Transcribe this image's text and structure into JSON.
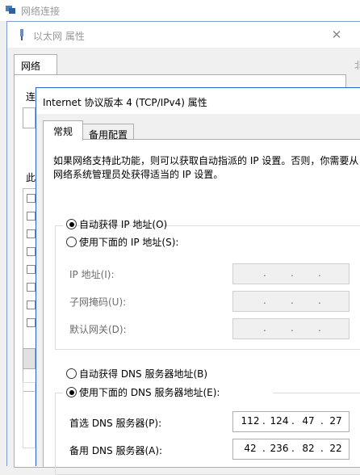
{
  "net_window": {
    "title": "网络连接"
  },
  "eth_window": {
    "title": "以太网 属性",
    "tab": "网络",
    "bg_label_conn": "连",
    "bg_label_this": "此",
    "right_edge_text": "北"
  },
  "ipv4_dialog": {
    "title": "Internet 协议版本 4 (TCP/IPv4) 属性",
    "tabs": [
      "常规",
      "备用配置"
    ],
    "description": "如果网络支持此功能，则可以获取自动指派的 IP 设置。否则，你需要从网络系统管理员处获得适当的 IP 设置。",
    "auto_ip": {
      "label": "自动获得 IP 地址(O)",
      "selected": true
    },
    "manual_ip": {
      "label": "使用下面的 IP 地址(S):",
      "selected": false,
      "fields": [
        {
          "label": "IP 地址(I):",
          "value": ""
        },
        {
          "label": "子网掩码(U):",
          "value": ""
        },
        {
          "label": "默认网关(D):",
          "value": ""
        }
      ]
    },
    "auto_dns": {
      "label": "自动获得 DNS 服务器地址(B)",
      "selected": false
    },
    "manual_dns": {
      "label": "使用下面的 DNS 服务器地址(E):",
      "selected": true,
      "fields": [
        {
          "label": "首选 DNS 服务器(P):",
          "octets": [
            "112",
            "124",
            "47",
            "27"
          ]
        },
        {
          "label": "备用 DNS 服务器(A):",
          "octets": [
            "42",
            "236",
            "82",
            "22"
          ]
        }
      ]
    }
  }
}
